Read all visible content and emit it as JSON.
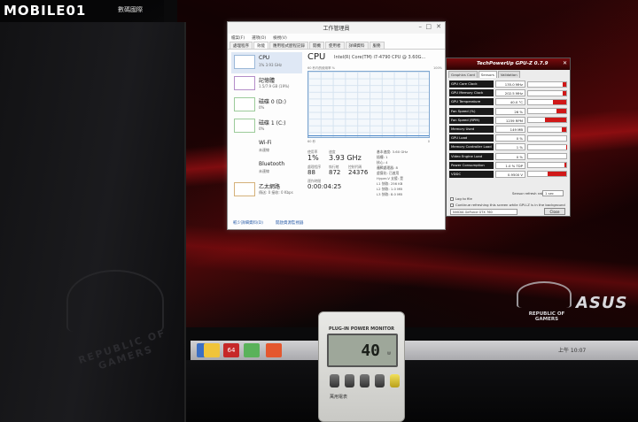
{
  "watermark": {
    "text": "MOBILE01",
    "sub": "數碼國際"
  },
  "taskmgr": {
    "title": "工作管理員",
    "menu": [
      "檔案(F)",
      "選項(O)",
      "檢視(V)"
    ],
    "tabs": [
      "處理程序",
      "效能",
      "應用程式歷程記錄",
      "開機",
      "使用者",
      "詳細資料",
      "服務"
    ],
    "active_tab": "效能",
    "resources": [
      {
        "name": "CPU",
        "value": "1% 3.93 GHz"
      },
      {
        "name": "記憶體",
        "value": "1.5/7.9 GB (19%)"
      },
      {
        "name": "磁碟 0 (D:)",
        "value": "0%"
      },
      {
        "name": "磁碟 1 (C:)",
        "value": "0%"
      },
      {
        "name": "Wi-Fi",
        "value": "未連線"
      },
      {
        "name": "Bluetooth",
        "value": "未連線"
      },
      {
        "name": "乙太網路",
        "value": "傳送: 0 接收: 0 Kbps"
      }
    ],
    "cpu_heading": "CPU",
    "cpu_name": "Intel(R) Core(TM) i7-4790 CPU @ 3.60G...",
    "graph_left_label": "60 秒內的使用率 %",
    "graph_right_label": "100%",
    "graph_bottom_left": "60 秒",
    "graph_bottom_right": "0",
    "stats": {
      "util_label": "使用率",
      "util_value": "1%",
      "speed_label": "速度",
      "speed_value": "3.93 GHz",
      "proc_label": "處理程序",
      "proc_value": "88",
      "thread_label": "執行緒",
      "thread_value": "872",
      "handle_label": "控制代碼",
      "handle_value": "24376",
      "uptime_label": "運作時間",
      "uptime_value": "0:00:04:25"
    },
    "specs": [
      "基本速度: 3.60 GHz",
      "插槽: 1",
      "核心: 4",
      "邏輯處理器: 8",
      "虛擬化: 已啟用",
      "Hyper-V 支援: 是",
      "L1 快取: 256 KB",
      "L2 快取: 1.0 MB",
      "L3 快取: 8.0 MB"
    ],
    "footer_less": "較少詳細資料(D)",
    "footer_monitor": "開啟資源監視器"
  },
  "gpuz": {
    "title": "TechPowerUp GPU-Z 0.7.9",
    "tabs": [
      "Graphics Card",
      "Sensors",
      "Validation"
    ],
    "active_tab": "Sensors",
    "rows": [
      {
        "label": "GPU Core Clock",
        "value": "135.0 MHz",
        "fill": 0.1
      },
      {
        "label": "GPU Memory Clock",
        "value": "202.5 MHz",
        "fill": 0.1
      },
      {
        "label": "GPU Temperature",
        "value": "40.0 °C",
        "fill": 0.35
      },
      {
        "label": "Fan Speed (%)",
        "value": "26 %",
        "fill": 0.26
      },
      {
        "label": "Fan Speed (RPM)",
        "value": "1239 RPM",
        "fill": 0.55
      },
      {
        "label": "Memory Used",
        "value": "149 MB",
        "fill": 0.12
      },
      {
        "label": "GPU Load",
        "value": "0 %",
        "fill": 0.0
      },
      {
        "label": "Memory Controller Load",
        "value": "1 %",
        "fill": 0.01
      },
      {
        "label": "Video Engine Load",
        "value": "0 %",
        "fill": 0.0
      },
      {
        "label": "Power Consumption",
        "value": "1.0 % TDP",
        "fill": 0.05
      },
      {
        "label": "VDDC",
        "value": "0.9500 V",
        "fill": 0.5
      }
    ],
    "log_label": "Log to file",
    "continue_label": "Continue refreshing this screen while GPU-Z is in the background",
    "refresh_label": "Sensor refresh rate",
    "refresh_value": "1 sec",
    "device": "NVIDIA GeForce GTX 760",
    "close_label": "Close"
  },
  "monitor": {
    "brand": "ASUS",
    "rog": "REPUBLIC OF GAMERS"
  },
  "tower": {
    "text": "REPUBLIC OF GAMERS"
  },
  "taskbar": {
    "clock": "上午 10:07"
  },
  "meter": {
    "title": "PLUG-IN POWER MONITOR",
    "reading": "40",
    "unit": "W",
    "brand": "萬用電表"
  },
  "colors": {
    "gpuz_bar": "#d01818",
    "wallpaper_red": "#c8141a",
    "meter_lcd": "#9ea79a"
  }
}
